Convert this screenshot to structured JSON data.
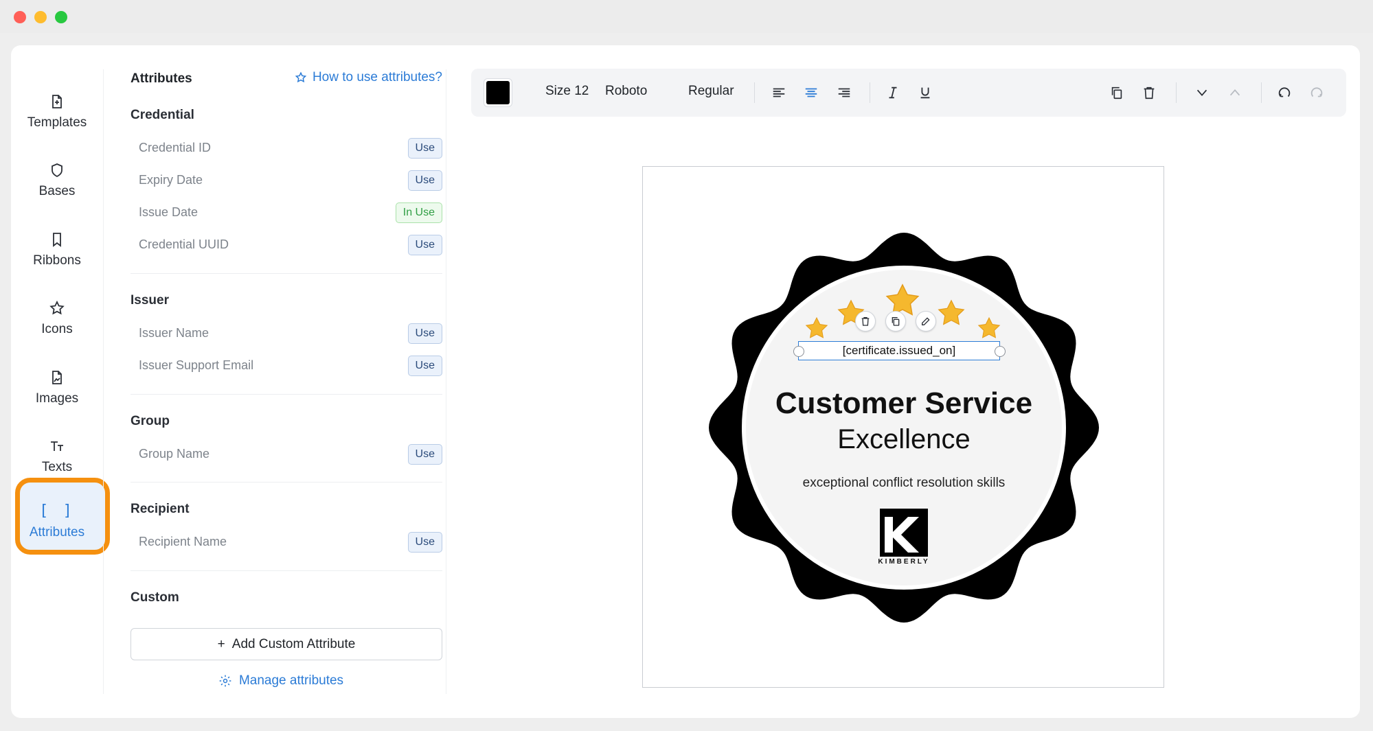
{
  "sidebar": {
    "items": [
      {
        "label": "Templates",
        "icon": "file-icon"
      },
      {
        "label": "Bases",
        "icon": "shield-icon"
      },
      {
        "label": "Ribbons",
        "icon": "bookmark-icon"
      },
      {
        "label": "Icons",
        "icon": "star-icon"
      },
      {
        "label": "Images",
        "icon": "image-file-icon"
      },
      {
        "label": "Texts",
        "icon": "text-size-icon"
      },
      {
        "label": "Attributes",
        "icon": "brackets-icon",
        "active": true
      }
    ],
    "brackets_glyph": "[ ]"
  },
  "panel": {
    "title": "Attributes",
    "help_link": "How to use attributes?",
    "sections": [
      {
        "title": "Credential",
        "rows": [
          {
            "name": "Credential ID",
            "action": "Use"
          },
          {
            "name": "Expiry Date",
            "action": "Use"
          },
          {
            "name": "Issue Date",
            "action": "In Use"
          },
          {
            "name": "Credential UUID",
            "action": "Use"
          }
        ]
      },
      {
        "title": "Issuer",
        "rows": [
          {
            "name": "Issuer Name",
            "action": "Use"
          },
          {
            "name": "Issuer Support Email",
            "action": "Use"
          }
        ]
      },
      {
        "title": "Group",
        "rows": [
          {
            "name": "Group Name",
            "action": "Use"
          }
        ]
      },
      {
        "title": "Recipient",
        "rows": [
          {
            "name": "Recipient Name",
            "action": "Use"
          }
        ]
      },
      {
        "title": "Custom",
        "rows": []
      }
    ],
    "add_custom_label": "Add Custom Attribute",
    "add_plus": "+",
    "manage_label": "Manage attributes"
  },
  "toolbar": {
    "color": "#000000",
    "size_label": "Size 12",
    "font_label": "Roboto",
    "weight_label": "Regular"
  },
  "canvas": {
    "selected_text": "[certificate.issued_on]",
    "title": "Customer Service",
    "subtitle": "Excellence",
    "description": "exceptional conflict resolution skills",
    "logo_text": "KIMBERLY"
  },
  "colors": {
    "accent": "#2b7bd6",
    "highlight": "#f5900f",
    "in_use": "#2f9e44",
    "star": "#f5b82e"
  }
}
